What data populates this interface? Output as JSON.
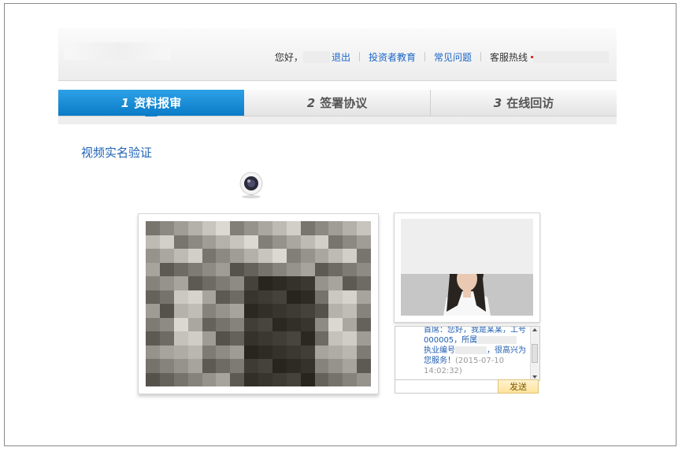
{
  "header": {
    "greeting": "您好，",
    "logout": "退出",
    "nav": [
      "投资者教育",
      "常见问题"
    ],
    "hotline_label": "客服热线"
  },
  "steps": [
    {
      "num": "1",
      "label": "资料报审",
      "active": true
    },
    {
      "num": "2",
      "label": "签署协议",
      "active": false
    },
    {
      "num": "3",
      "label": "在线回访",
      "active": false
    }
  ],
  "section_title": "视频实名验证",
  "icons": {
    "camera": "webcam-icon"
  },
  "chat": {
    "line1": "首席：您好，我是某某，工号",
    "line2": "000005，所属",
    "line3": "执业编号",
    "line3b": "，很高兴为",
    "line4": "您服务！",
    "timestamp": "(2015-07-10 14:02:32)"
  },
  "send_label": "发送",
  "colors": {
    "accent": "#0a7bc7",
    "link": "#1a66c7",
    "send_bg": "#fde39c"
  }
}
